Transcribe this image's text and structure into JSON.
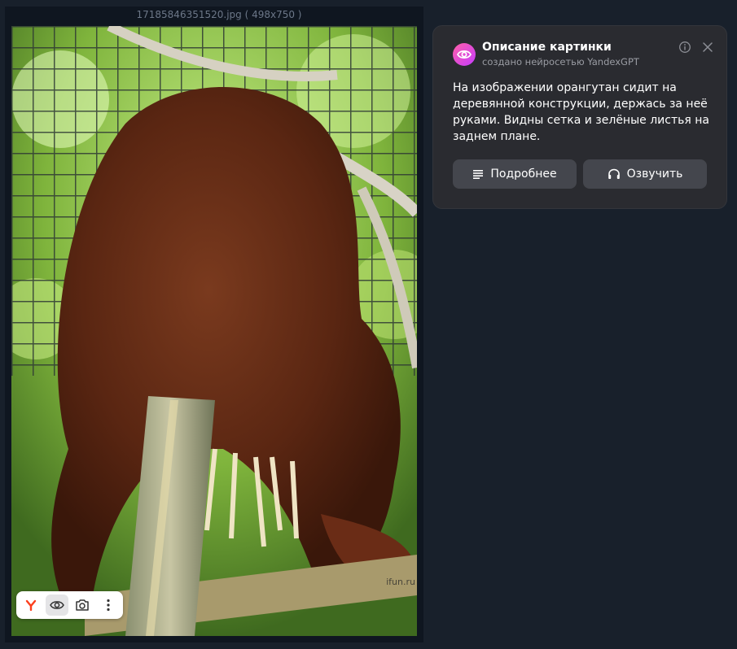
{
  "viewer": {
    "title": "17185846351520.jpg ( 498x750 )",
    "watermark": "ifun.ru",
    "photo_alt": "orangutan"
  },
  "toolbar": {
    "items": [
      {
        "icon": "yandex-logo-icon",
        "active": false
      },
      {
        "icon": "eye-icon",
        "active": true
      },
      {
        "icon": "camera-search-icon",
        "active": false
      },
      {
        "icon": "more-vertical-icon",
        "active": false
      }
    ]
  },
  "card": {
    "title": "Описание картинки",
    "subtitle": "создано нейросетью YandexGPT",
    "description": "На изображении орангутан сидит на деревянной конструкции, держась за неё руками. Видны сетка и зелёные листья на заднем плане.",
    "more_label": "Подробнее",
    "speak_label": "Озвучить",
    "info_icon": "info-icon",
    "close_icon": "close-icon"
  },
  "colors": {
    "background": "#18202b",
    "card_bg": "#2a2b30",
    "button_bg": "#44464d",
    "logo_gradient_start": "#ff5fa8",
    "logo_gradient_end": "#c63cff"
  }
}
